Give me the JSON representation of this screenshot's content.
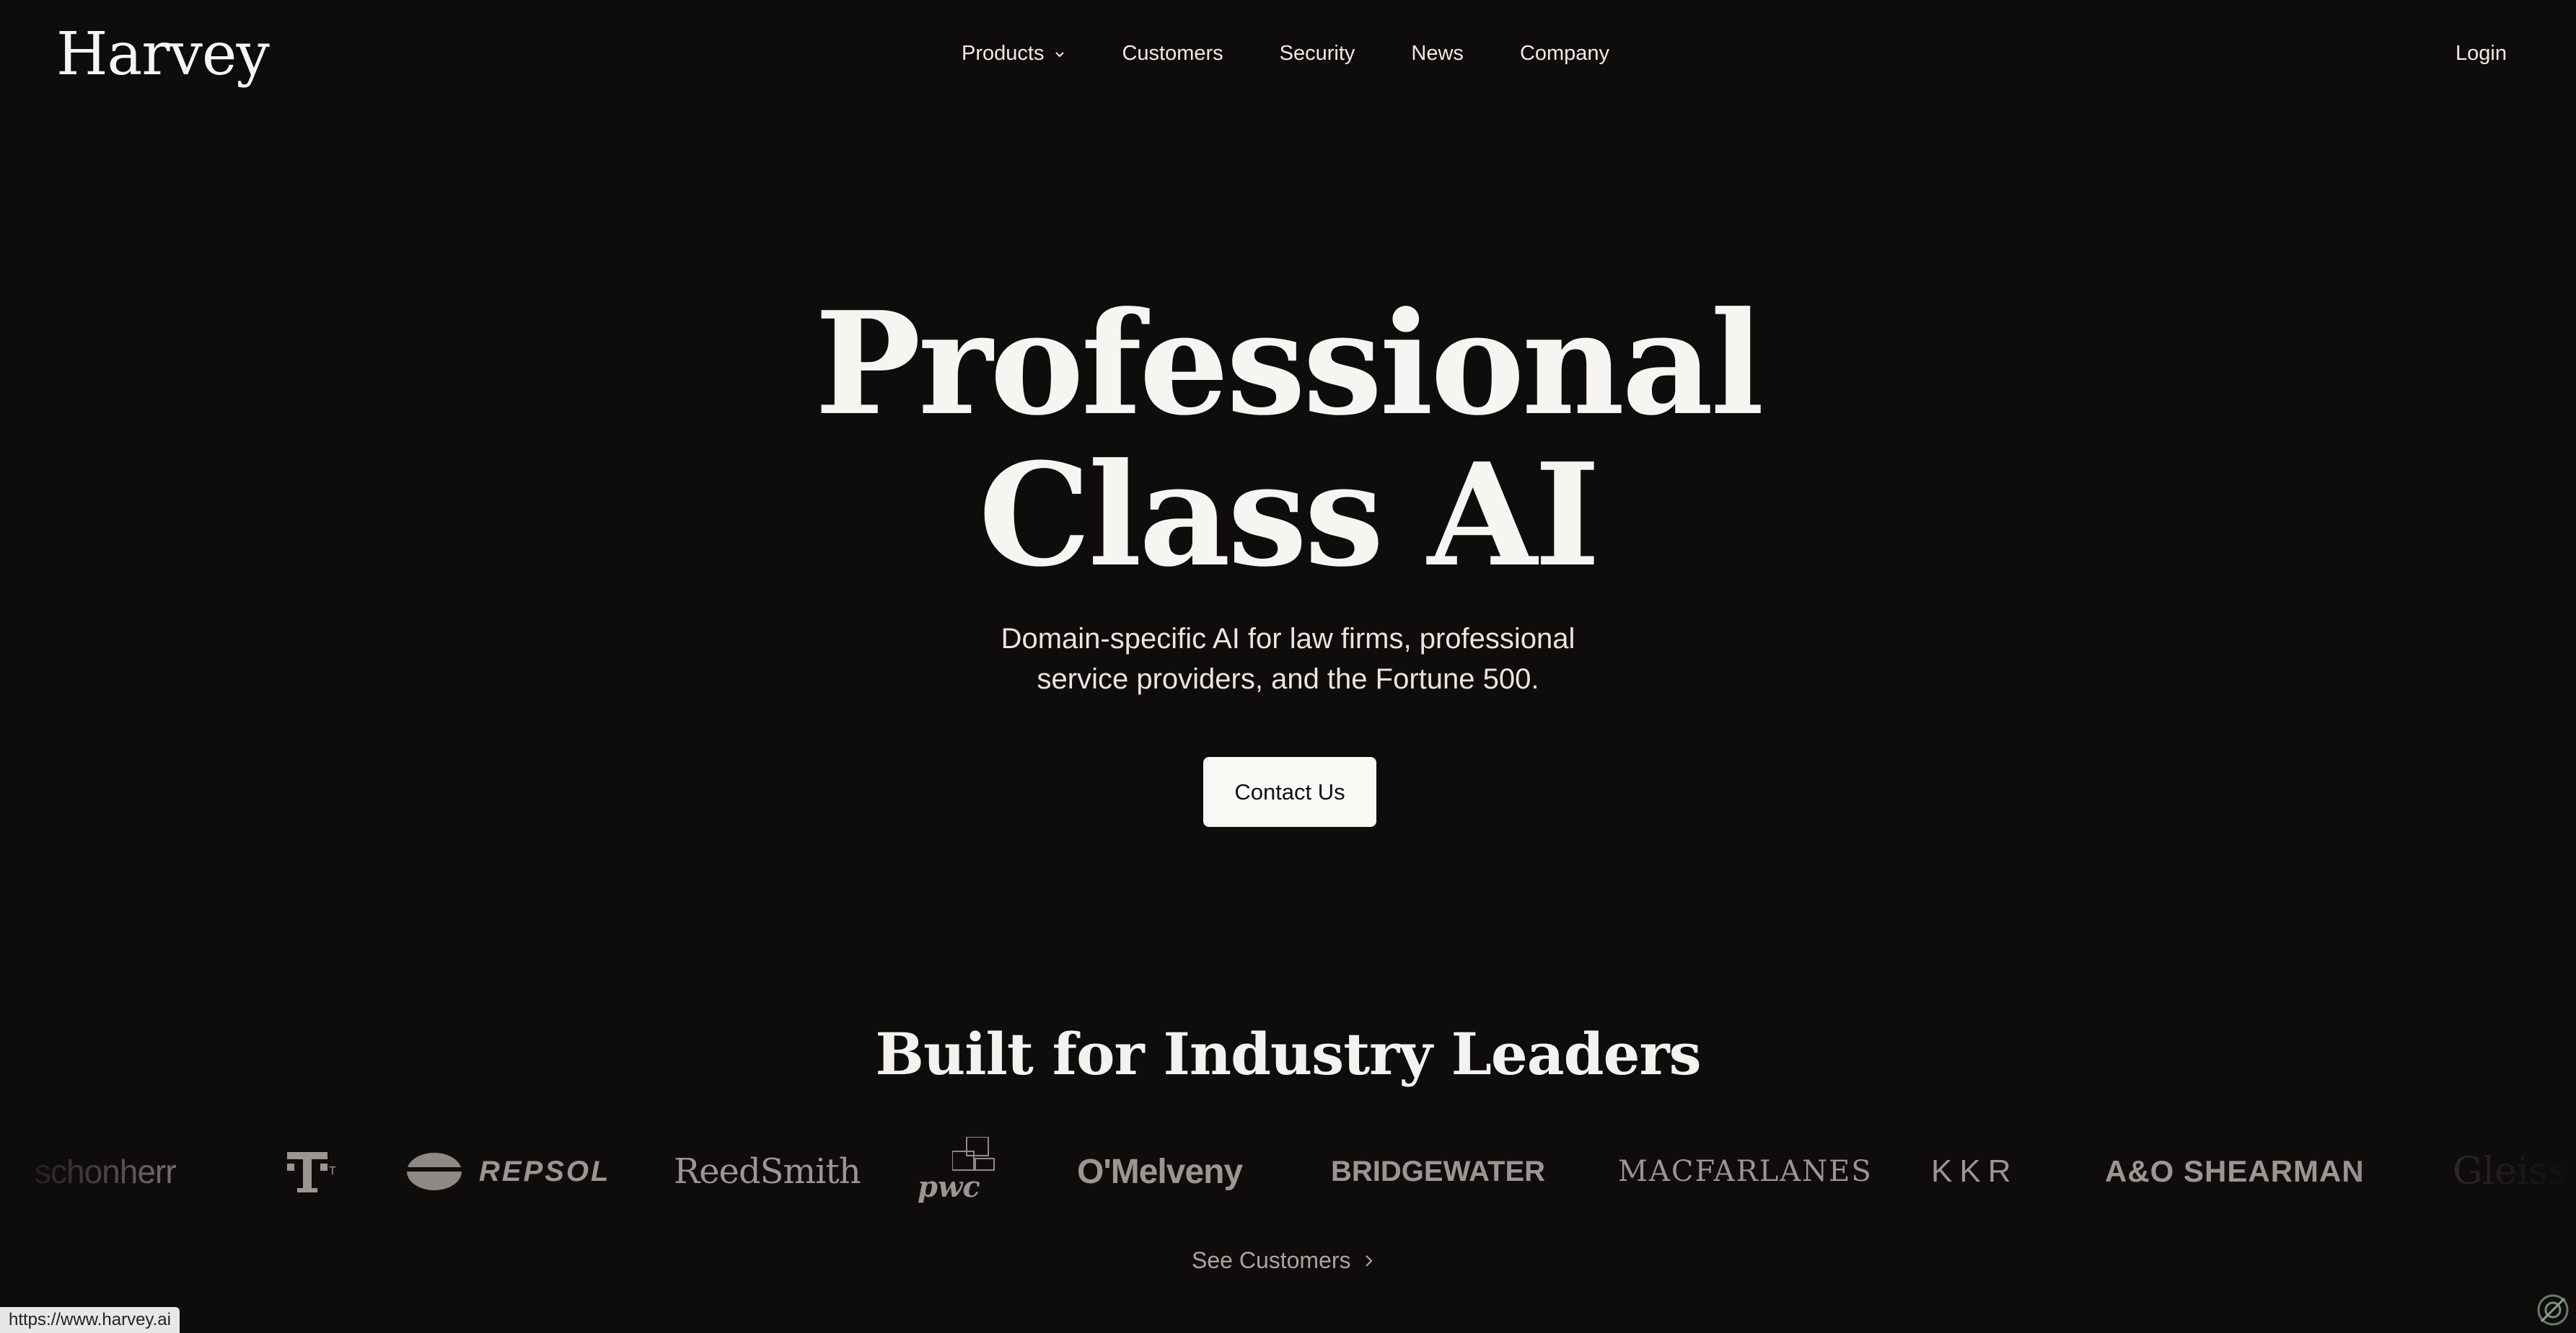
{
  "header": {
    "logo": "Harvey",
    "nav": [
      {
        "label": "Products",
        "has_dropdown": true
      },
      {
        "label": "Customers"
      },
      {
        "label": "Security"
      },
      {
        "label": "News"
      },
      {
        "label": "Company"
      }
    ],
    "login": "Login"
  },
  "hero": {
    "title_line1": "Professional",
    "title_line2": "Class AI",
    "subtitle_line1": "Domain-specific AI for law firms, professional",
    "subtitle_line2": "service providers, and the Fortune 500.",
    "cta": "Contact Us"
  },
  "leaders": {
    "heading": "Built for Industry Leaders",
    "logos": [
      "schonherr",
      "T",
      "REPSOL",
      "ReedSmith",
      "pwc",
      "O'Melveny",
      "BRIDGEWATER",
      "MACFARLANES",
      "KKR",
      "A&O SHEARMAN",
      "Gleiss L"
    ],
    "see_customers": "See Customers"
  },
  "status_bar": {
    "url": "https://www.harvey.ai"
  },
  "colors": {
    "background": "#0f0d0c",
    "text": "#f4f2ee",
    "logo_gray": "#9a9692",
    "button_bg": "#faf8f4"
  }
}
